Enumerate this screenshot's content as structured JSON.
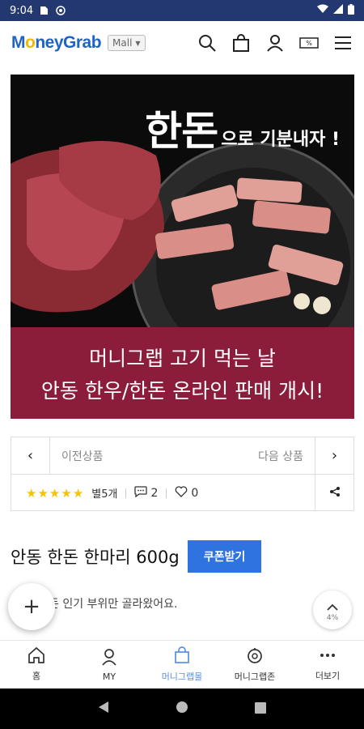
{
  "status_bar": {
    "time": "9:04"
  },
  "header": {
    "logo_prefix": "M",
    "logo_o": "o",
    "logo_suffix": "neyGrab",
    "mall_select": "Mall"
  },
  "banner": {
    "headline_big": "한돈",
    "headline_small": "으로 기분내자 !",
    "line1": "머니그랩 고기 먹는 날",
    "line2": "안동 한우/한돈 온라인 판매 개시!"
  },
  "product_nav": {
    "prev_label": "이전상품",
    "next_label": "다음 상품",
    "rating_stars": 5,
    "review_count": "별5개",
    "comment_count": "2",
    "like_count": "0"
  },
  "product": {
    "title": "안동 한돈 한마리 600g",
    "coupon_label": "쿠폰받기",
    "subtitle": "돈 인기 부위만 골라왔어요."
  },
  "scroll_top": {
    "percent": "4%"
  },
  "bottom_nav": {
    "items": [
      {
        "label": "홈",
        "icon": "home-icon"
      },
      {
        "label": "MY",
        "icon": "person-icon"
      },
      {
        "label": "머니그랩몰",
        "icon": "mall-icon"
      },
      {
        "label": "머니그랩존",
        "icon": "zone-icon"
      },
      {
        "label": "더보기",
        "icon": "more-icon"
      }
    ]
  },
  "colors": {
    "status_bar": "#233870",
    "brand_blue": "#1e63c8",
    "banner_red": "#8c1d3a",
    "coupon_blue": "#2f73e0",
    "star": "#f5c400",
    "active_tab": "#5a8fe4"
  }
}
